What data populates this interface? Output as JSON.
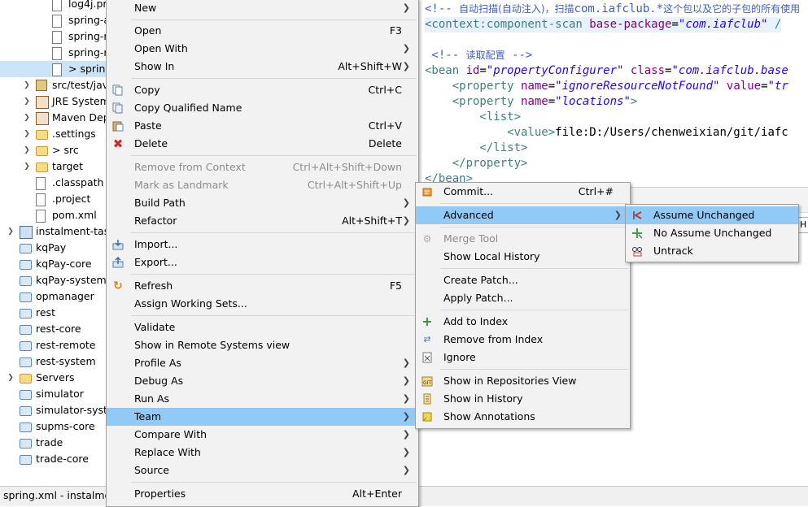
{
  "tree": {
    "items": [
      {
        "label": "log4j.pr",
        "indent": 66,
        "icon": "xml-file",
        "arrow": ""
      },
      {
        "label": "spring-a",
        "indent": 66,
        "icon": "xml-file",
        "arrow": ""
      },
      {
        "label": "spring-r",
        "indent": 66,
        "icon": "xml-file",
        "arrow": ""
      },
      {
        "label": "spring-r",
        "indent": 66,
        "icon": "xml-file",
        "arrow": ""
      },
      {
        "label": "> spring",
        "indent": 66,
        "icon": "xml-file",
        "arrow": "",
        "selected": true
      },
      {
        "label": "src/test/jav",
        "indent": 46,
        "icon": "package-folder",
        "arrow": ">"
      },
      {
        "label": "JRE System",
        "indent": 46,
        "icon": "library",
        "arrow": ">"
      },
      {
        "label": "Maven Dep",
        "indent": 46,
        "icon": "library",
        "arrow": ">"
      },
      {
        "label": ".settings",
        "indent": 46,
        "icon": "folder",
        "arrow": ">"
      },
      {
        "label": "> src",
        "indent": 46,
        "icon": "folder",
        "arrow": ">"
      },
      {
        "label": "target",
        "indent": 46,
        "icon": "folder",
        "arrow": ">"
      },
      {
        "label": ".classpath",
        "indent": 46,
        "icon": "xml-file",
        "arrow": ""
      },
      {
        "label": ".project",
        "indent": 46,
        "icon": "xml-file",
        "arrow": ""
      },
      {
        "label": "pom.xml",
        "indent": 46,
        "icon": "xml-file",
        "arrow": ""
      },
      {
        "label": "instalment-task",
        "indent": 26,
        "icon": "project",
        "arrow": ">"
      },
      {
        "label": "kqPay",
        "indent": 26,
        "icon": "project-folder",
        "arrow": ""
      },
      {
        "label": "kqPay-core",
        "indent": 26,
        "icon": "project-folder",
        "arrow": ""
      },
      {
        "label": "kqPay-system",
        "indent": 26,
        "icon": "project-folder",
        "arrow": ""
      },
      {
        "label": "opmanager",
        "indent": 26,
        "icon": "project-folder",
        "arrow": ""
      },
      {
        "label": "rest",
        "indent": 26,
        "icon": "project-folder",
        "arrow": ""
      },
      {
        "label": "rest-core",
        "indent": 26,
        "icon": "project-folder",
        "arrow": ""
      },
      {
        "label": "rest-remote",
        "indent": 26,
        "icon": "project-folder",
        "arrow": ""
      },
      {
        "label": "rest-system",
        "indent": 26,
        "icon": "project-folder",
        "arrow": ""
      },
      {
        "label": "Servers",
        "indent": 26,
        "icon": "folder",
        "arrow": ">"
      },
      {
        "label": "simulator",
        "indent": 26,
        "icon": "project-folder",
        "arrow": ""
      },
      {
        "label": "simulator-syste",
        "indent": 26,
        "icon": "project-folder",
        "arrow": ""
      },
      {
        "label": "supms-core",
        "indent": 26,
        "icon": "project-folder",
        "arrow": ""
      },
      {
        "label": "trade",
        "indent": 26,
        "icon": "project-folder",
        "arrow": ""
      },
      {
        "label": "trade-core",
        "indent": 26,
        "icon": "project-folder",
        "arrow": ""
      }
    ]
  },
  "editor": {
    "lines": [
      [
        [
          "cmt",
          "<!-- "
        ],
        [
          "cmt cjk",
          "自动扫描(自动注入)，扫描"
        ],
        [
          "cmt",
          "com.iafclub.*"
        ],
        [
          "cmt cjk",
          "这个包以及它的子包的所有使用"
        ]
      ],
      [
        [
          "tag",
          "<context:component-scan "
        ],
        [
          "attr",
          "base-package"
        ],
        [
          "txt",
          "="
        ],
        [
          "val",
          "\"com.iafclub\""
        ],
        [
          "tag",
          " /"
        ]
      ],
      [],
      [
        [
          "cmt",
          " <!-- "
        ],
        [
          "cmt cjk",
          "读取配置"
        ],
        [
          "cmt",
          " -->"
        ]
      ],
      [
        [
          "tag",
          "<bean "
        ],
        [
          "attr",
          "id"
        ],
        [
          "txt",
          "="
        ],
        [
          "val",
          "\"propertyConfigurer\""
        ],
        [
          "txt",
          " "
        ],
        [
          "attr",
          "class"
        ],
        [
          "txt",
          "="
        ],
        [
          "val",
          "\"com.iafclub.base"
        ]
      ],
      [
        [
          "tag",
          "    <property "
        ],
        [
          "attr",
          "name"
        ],
        [
          "txt",
          "="
        ],
        [
          "val",
          "\"ignoreResourceNotFound\""
        ],
        [
          "txt",
          " "
        ],
        [
          "attr",
          "value"
        ],
        [
          "txt",
          "="
        ],
        [
          "val",
          "\"tr"
        ]
      ],
      [
        [
          "tag",
          "    <property "
        ],
        [
          "attr",
          "name"
        ],
        [
          "txt",
          "="
        ],
        [
          "val",
          "\"locations\""
        ],
        [
          "tag",
          ">"
        ]
      ],
      [
        [
          "tag",
          "        <list>"
        ]
      ],
      [
        [
          "tag",
          "            <value>"
        ],
        [
          "txt",
          "file:D:/Users/chenweixian/git/iafc"
        ]
      ],
      [
        [
          "tag",
          "        </list>"
        ]
      ],
      [
        [
          "tag",
          "    </property>"
        ]
      ],
      [
        [
          "tag",
          "</bean>"
        ]
      ]
    ],
    "lower_tab_label": "H"
  },
  "status_bar": {
    "text": "spring.xml - instalmen"
  },
  "context_menu": {
    "new": {
      "label": "New",
      "shortcut": ""
    },
    "open": {
      "label": "Open",
      "shortcut": "F3"
    },
    "open_with": {
      "label": "Open With",
      "shortcut": ""
    },
    "show_in": {
      "label": "Show In",
      "shortcut": "Alt+Shift+W"
    },
    "copy": {
      "label": "Copy",
      "shortcut": "Ctrl+C"
    },
    "copy_qualified": {
      "label": "Copy Qualified Name",
      "shortcut": ""
    },
    "paste": {
      "label": "Paste",
      "shortcut": "Ctrl+V"
    },
    "delete": {
      "label": "Delete",
      "shortcut": "Delete"
    },
    "remove_context": {
      "label": "Remove from Context",
      "shortcut": "Ctrl+Alt+Shift+Down"
    },
    "mark_landmark": {
      "label": "Mark as Landmark",
      "shortcut": "Ctrl+Alt+Shift+Up"
    },
    "build_path": {
      "label": "Build Path",
      "shortcut": ""
    },
    "refactor": {
      "label": "Refactor",
      "shortcut": "Alt+Shift+T"
    },
    "import": {
      "label": "Import...",
      "shortcut": ""
    },
    "export": {
      "label": "Export...",
      "shortcut": ""
    },
    "refresh": {
      "label": "Refresh",
      "shortcut": "F5"
    },
    "assign_ws": {
      "label": "Assign Working Sets...",
      "shortcut": ""
    },
    "validate": {
      "label": "Validate",
      "shortcut": ""
    },
    "show_remote": {
      "label": "Show in Remote Systems view",
      "shortcut": ""
    },
    "profile_as": {
      "label": "Profile As",
      "shortcut": ""
    },
    "debug_as": {
      "label": "Debug As",
      "shortcut": ""
    },
    "run_as": {
      "label": "Run As",
      "shortcut": ""
    },
    "team": {
      "label": "Team",
      "shortcut": ""
    },
    "compare_with": {
      "label": "Compare With",
      "shortcut": ""
    },
    "replace_with": {
      "label": "Replace With",
      "shortcut": ""
    },
    "source": {
      "label": "Source",
      "shortcut": ""
    },
    "properties": {
      "label": "Properties",
      "shortcut": "Alt+Enter"
    }
  },
  "team_menu": {
    "commit": {
      "label": "Commit...",
      "shortcut": "Ctrl+#"
    },
    "advanced": {
      "label": "Advanced"
    },
    "merge_tool": {
      "label": "Merge Tool"
    },
    "show_local_history": {
      "label": "Show Local History"
    },
    "create_patch": {
      "label": "Create Patch..."
    },
    "apply_patch": {
      "label": "Apply Patch..."
    },
    "add_to_index": {
      "label": "Add to Index"
    },
    "remove_from_index": {
      "label": "Remove from Index"
    },
    "ignore": {
      "label": "Ignore"
    },
    "show_repos_view": {
      "label": "Show in Repositories View"
    },
    "show_history": {
      "label": "Show in History"
    },
    "show_annotations": {
      "label": "Show Annotations"
    }
  },
  "advanced_menu": {
    "assume_unchanged": {
      "label": "Assume Unchanged"
    },
    "no_assume_unchanged": {
      "label": "No Assume Unchanged"
    },
    "untrack": {
      "label": "Untrack"
    }
  },
  "colors": {
    "menu_bg": "#f2f2f2",
    "menu_highlight": "#91c9f7",
    "xml_comment": "#3f5fbf",
    "xml_tag": "#3f7f7f",
    "xml_attr": "#7f007f",
    "xml_value": "#2a00ff"
  },
  "icons": {
    "copy": "copy-icon",
    "copy_qualified": "copy-qualified-icon",
    "paste": "paste-icon",
    "delete": "delete-icon",
    "import": "import-icon",
    "export": "export-icon",
    "refresh": "refresh-icon",
    "commit": "commit-icon",
    "merge_tool": "merge-tool-icon",
    "add_to_index": "add-to-index-icon",
    "remove_from_index": "remove-from-index-icon",
    "ignore": "ignore-icon",
    "show_repos_view": "git-repository-icon",
    "show_history": "history-icon",
    "show_annotations": "annotations-icon",
    "assume_unchanged": "assume-unchanged-icon",
    "no_assume_unchanged": "no-assume-unchanged-icon",
    "untrack": "untrack-icon"
  }
}
